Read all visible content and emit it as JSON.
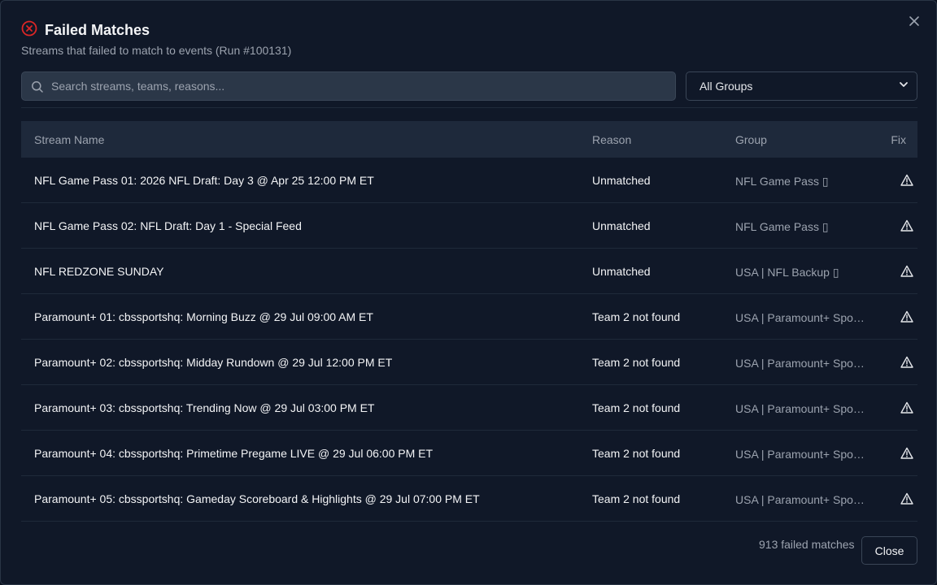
{
  "dialog": {
    "title": "Failed Matches",
    "subtitle": "Streams that failed to match to events (Run #100131)",
    "title_icon": "x-circle-icon",
    "close_icon": "close-icon"
  },
  "search": {
    "placeholder": "Search streams, teams, reasons...",
    "value": ""
  },
  "group_filter": {
    "selected": "All Groups"
  },
  "table": {
    "headers": [
      "Stream Name",
      "Reason",
      "Group",
      "Fix"
    ],
    "rows": [
      {
        "name": "NFL Game Pass 01: 2026 NFL Draft: Day 3 @ Apr 25 12:00 PM ET",
        "reason": "Unmatched",
        "group": "NFL Game Pass ▯"
      },
      {
        "name": "NFL Game Pass 02: NFL Draft: Day 1 - Special Feed",
        "reason": "Unmatched",
        "group": "NFL Game Pass ▯"
      },
      {
        "name": "NFL REDZONE SUNDAY",
        "reason": "Unmatched",
        "group": "USA | NFL Backup ▯"
      },
      {
        "name": "Paramount+ 01: cbssportshq: Morning Buzz @ 29 Jul 09:00 AM ET",
        "reason": "Team 2 not found",
        "group": "USA | Paramount+ Spo…"
      },
      {
        "name": "Paramount+ 02: cbssportshq: Midday Rundown @ 29 Jul 12:00 PM ET",
        "reason": "Team 2 not found",
        "group": "USA | Paramount+ Spo…"
      },
      {
        "name": "Paramount+ 03: cbssportshq: Trending Now @ 29 Jul 03:00 PM ET",
        "reason": "Team 2 not found",
        "group": "USA | Paramount+ Spo…"
      },
      {
        "name": "Paramount+ 04: cbssportshq: Primetime Pregame LIVE @ 29 Jul 06:00 PM ET",
        "reason": "Team 2 not found",
        "group": "USA | Paramount+ Spo…"
      },
      {
        "name": "Paramount+ 05: cbssportshq: Gameday Scoreboard & Highlights @ 29 Jul 07:00 PM ET",
        "reason": "Team 2 not found",
        "group": "USA | Paramount+ Spo…"
      }
    ],
    "fix_icon": "warning-triangle-icon"
  },
  "footer": {
    "count_text": "913 failed matches",
    "close_label": "Close"
  },
  "colors": {
    "background": "#101828",
    "accent_error": "#dc2626",
    "header_bg": "#1e293b",
    "input_bg": "#2b3748"
  }
}
